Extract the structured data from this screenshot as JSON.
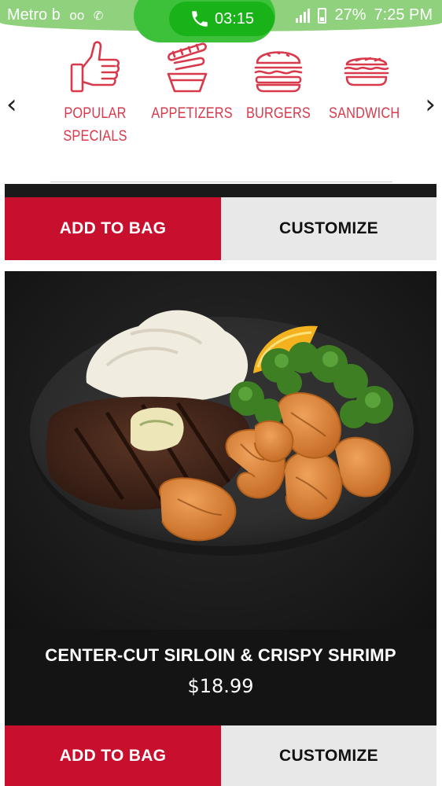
{
  "status_bar": {
    "carrier": "Metro b",
    "call_timer": "03:15",
    "battery": "27%",
    "time": "7:25 PM",
    "icons": [
      "voicemail-icon",
      "hd-call-icon",
      "phone-icon",
      "signal-icon",
      "battery-icon"
    ]
  },
  "category_nav": {
    "prev_arrow": "‹",
    "next_arrow": "›",
    "items": [
      {
        "line1": "POPULAR",
        "line2": "SPECIALS",
        "icon": "thumbs-up-icon"
      },
      {
        "line1": "APPETIZERS",
        "line2": "",
        "icon": "appetizer-basket-icon"
      },
      {
        "line1": "BURGERS",
        "line2": "",
        "icon": "burger-icon"
      },
      {
        "line1": "SANDWICH",
        "line2": "",
        "icon": "sandwich-icon"
      }
    ],
    "accent_color": "#d83a4c"
  },
  "menu_items": [
    {
      "add_label": "ADD TO BAG",
      "customize_label": "CUSTOMIZE"
    },
    {
      "name": "CENTER-CUT SIRLOIN & CRISPY SHRIMP",
      "price": "$18.99",
      "add_label": "ADD TO BAG",
      "customize_label": "CUSTOMIZE"
    }
  ],
  "colors": {
    "add_button": "#c8102e",
    "customize_button": "#e8e8e8",
    "status_bar": "#8fd17c",
    "call_pill": "#19b319"
  }
}
